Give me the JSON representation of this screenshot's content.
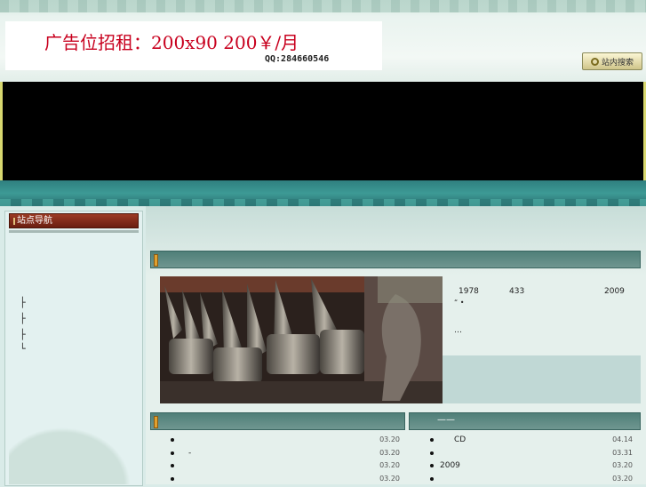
{
  "header": {
    "ad_text": "广告位招租：200x90  200￥/月",
    "ad_qq": "QQ:284660546",
    "search_button_label": "站内搜索"
  },
  "sidebar": {
    "title": "站点导航",
    "tree_glyphs": [
      "├",
      "├",
      "├",
      "└"
    ]
  },
  "feature": {
    "text_line1": [
      "1978",
      "433",
      "2009"
    ],
    "text_line2": "“ •",
    "text_more": "…"
  },
  "news_left": {
    "items": [
      {
        "text": "",
        "date": "03.20"
      },
      {
        "text": "-",
        "date": "03.20"
      },
      {
        "text": "",
        "date": "03.20"
      },
      {
        "text": "",
        "date": "03.20"
      }
    ]
  },
  "news_right": {
    "title": "——",
    "items": [
      {
        "text": "CD",
        "date": "04.14"
      },
      {
        "text": "",
        "date": "03.31"
      },
      {
        "text": "2009",
        "date": "03.20"
      },
      {
        "text": "",
        "date": "03.20"
      }
    ]
  },
  "colors": {
    "ad_red": "#c8001e",
    "nav_title_bg": "#7a2a17",
    "section_header": "#5f8a84",
    "teal_band": "#3d9a95"
  }
}
